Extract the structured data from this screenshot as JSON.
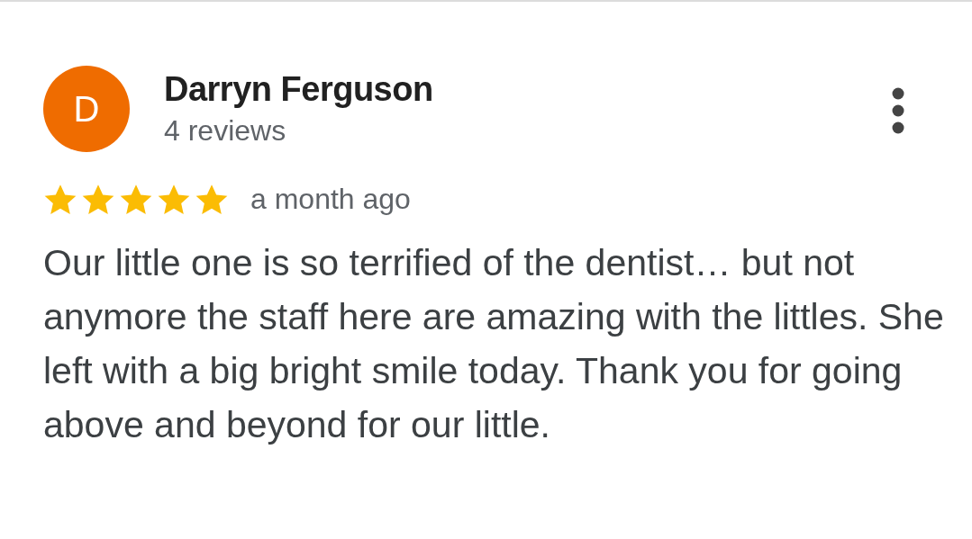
{
  "review": {
    "avatar_letter": "D",
    "author": "Darryn Ferguson",
    "review_count": "4 reviews",
    "stars": 5,
    "time": "a month ago",
    "text": "Our little one is so terrified of the dentist… but not anymore the staff here are amazing with the littles. She left with a big bright smile today. Thank you for going above and beyond for our little."
  }
}
